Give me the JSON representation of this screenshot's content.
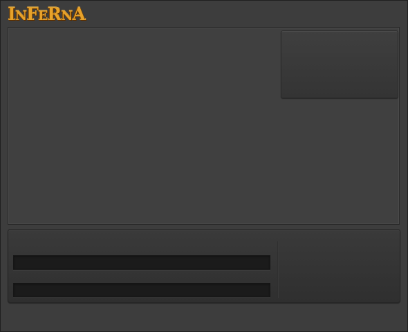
{
  "app": {
    "logo": {
      "letters": [
        {
          "char": "I",
          "size": "big"
        },
        {
          "char": "N",
          "size": "small"
        },
        {
          "char": "F",
          "size": "big"
        },
        {
          "char": "E",
          "size": "small"
        },
        {
          "char": "R",
          "size": "big"
        },
        {
          "char": "N",
          "size": "small"
        },
        {
          "char": "A",
          "size": "big"
        }
      ],
      "color": "#e7a22a"
    }
  },
  "viewport": {
    "background": "#404040"
  },
  "chat": {
    "input_1": {
      "value": "",
      "placeholder": ""
    },
    "input_2": {
      "value": "",
      "placeholder": ""
    }
  }
}
